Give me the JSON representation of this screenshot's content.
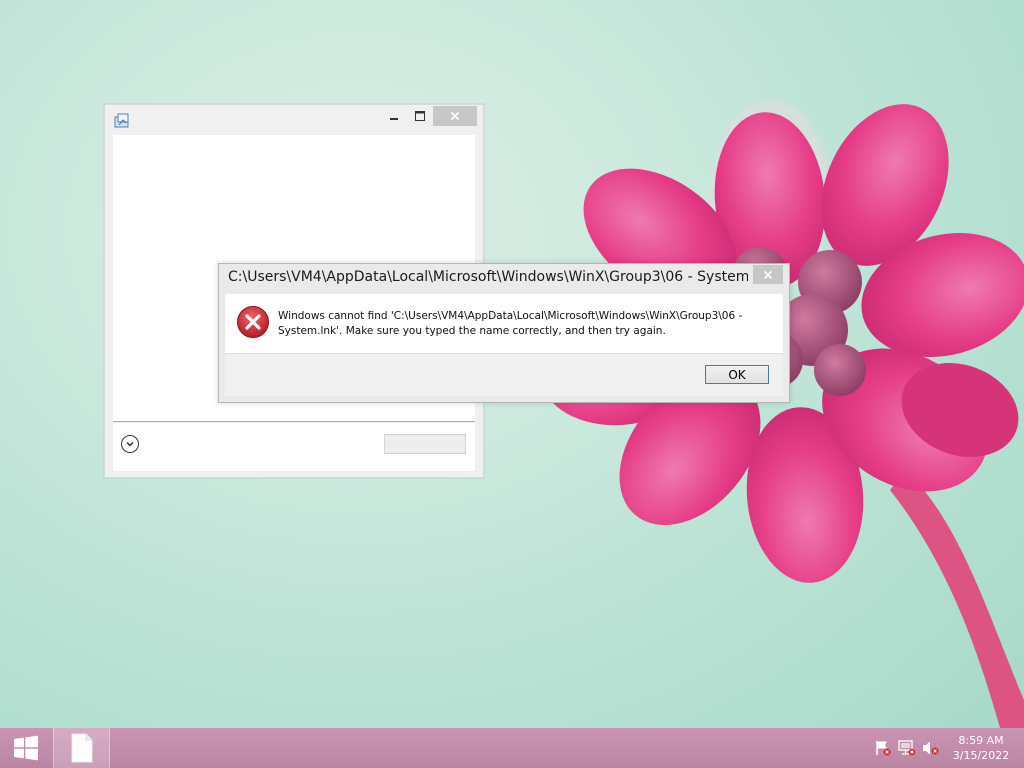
{
  "desktop": {
    "background_colors": {
      "top": "#dfeee6",
      "bottom": "#a6d8c8",
      "petal": "#e83a86",
      "petal_light": "#f06aa3"
    }
  },
  "background_window": {
    "icon": "program-icon",
    "controls": {
      "minimize_icon": "minimize-icon",
      "maximize_icon": "maximize-icon",
      "close_icon": "close-icon"
    },
    "expand_icon": "chevron-down-circle-icon",
    "footer_button_label": ""
  },
  "error_dialog": {
    "title": "C:\\Users\\VM4\\AppData\\Local\\Microsoft\\Windows\\WinX\\Group3\\06 - System...",
    "icon": "error-icon",
    "message_line1": "Windows cannot find 'C:\\Users\\VM4\\AppData\\Local\\Microsoft\\Windows\\WinX\\Group3\\06 -",
    "message_line2": "System.lnk'. Make sure you typed the name correctly, and then try again.",
    "ok_label": "OK",
    "close_icon": "close-icon",
    "accent_color": "#3c7fb1"
  },
  "taskbar": {
    "start_icon": "windows-logo-icon",
    "items": [
      {
        "icon": "document-icon"
      }
    ],
    "tray": [
      {
        "icon": "action-center-flag-icon"
      },
      {
        "icon": "network-icon"
      },
      {
        "icon": "volume-muted-icon"
      }
    ],
    "clock": {
      "time": "8:59 AM",
      "date": "3/15/2022"
    },
    "color": "#c995b3"
  }
}
